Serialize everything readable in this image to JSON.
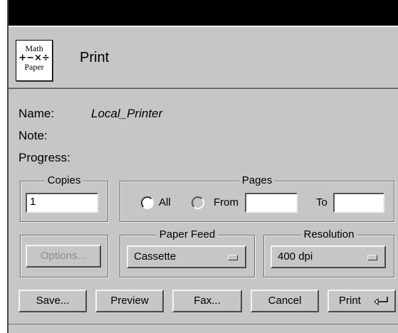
{
  "dialog": {
    "title": "Print",
    "logo": {
      "line1": "Math",
      "line2": "+−×÷",
      "line3": "Paper"
    }
  },
  "info": {
    "name_label": "Name:",
    "name_value": "Local_Printer",
    "note_label": "Note:",
    "progress_label": "Progress:"
  },
  "copies": {
    "label": "Copies",
    "value": "1"
  },
  "pages": {
    "label": "Pages",
    "all_label": "All",
    "from_label": "From",
    "to_label": "To",
    "from_value": "",
    "to_value": "",
    "selected": "All"
  },
  "options_button": "Options...",
  "paper_feed": {
    "label": "Paper Feed",
    "value": "Cassette"
  },
  "resolution": {
    "label": "Resolution",
    "value": "400 dpi"
  },
  "buttons": {
    "save": "Save...",
    "preview": "Preview",
    "fax": "Fax...",
    "cancel": "Cancel",
    "print": "Print"
  },
  "icons": {
    "print_return": "return-arrow-icon",
    "menu_indicator": "option-menu-indicator-icon"
  }
}
